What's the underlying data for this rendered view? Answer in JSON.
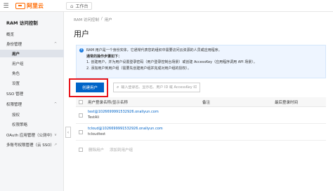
{
  "header": {
    "logo_text": "阿里云",
    "workbench": "工作台"
  },
  "sidebar": {
    "title": "RAM 访问控制",
    "items": [
      {
        "label": "概览",
        "level": 1
      },
      {
        "label": "身份管理",
        "level": 1,
        "chevron": "^"
      },
      {
        "label": "用户",
        "level": 2,
        "active": true
      },
      {
        "label": "用户组",
        "level": 2
      },
      {
        "label": "角色",
        "level": 2
      },
      {
        "label": "设置",
        "level": 2
      },
      {
        "label": "SSO 管理",
        "level": 1
      },
      {
        "label": "权限管理",
        "level": 1,
        "chevron": "^"
      },
      {
        "label": "授权",
        "level": 2
      },
      {
        "label": "权限策略",
        "level": 2
      },
      {
        "label": "OAuth 应用管理（公测中）",
        "level": 1,
        "chevron": "v"
      },
      {
        "label": "多账号权限管理（云 SSO）",
        "level": 1,
        "chevron": "↗"
      }
    ]
  },
  "breadcrumb": [
    "RAM 访问控制",
    "/",
    "用户"
  ],
  "page_title": "用户",
  "info": {
    "line1": "RAM 用户是一个身份实体，它通常代表您的组织中需要访问云资源的人员或应用程序。",
    "line2": "通常的操作步骤如下：",
    "line3": "1. 创建用户，并为用户设置登录密码（用户登录控制台场景）或创建 AccessKey（应用程序调用 API 场景）。",
    "line4": "2. 添加用户到用户组（需要先创建用户组并完成对用户组的授权）。"
  },
  "toolbar": {
    "create_label": "创建用户",
    "search_placeholder": "输入登录名、显示名、用户 ID 或 AccessKey ID"
  },
  "table": {
    "columns": [
      "用户登录名称/显示名称",
      "备注",
      "最后登录时间"
    ],
    "rows": [
      {
        "login": "test@1026699991532926.onaliyun.com",
        "display": "TestAli",
        "note": "",
        "last_login": ""
      },
      {
        "login": "tcloud@1026699991532926.onaliyun.com",
        "display": "tcloudtest",
        "note": "",
        "last_login": ""
      }
    ]
  },
  "bottom_actions": {
    "delete_label": "删除用户",
    "add_group_label": "添加到用户组"
  },
  "colors": {
    "brand": "#ff6a00",
    "primary": "#0064c8",
    "highlight": "#e8141b"
  }
}
